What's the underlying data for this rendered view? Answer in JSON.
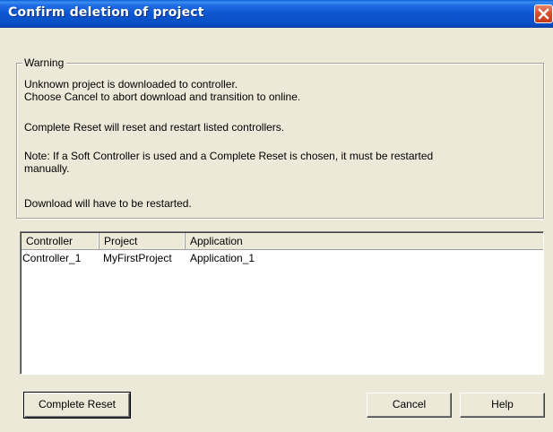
{
  "window": {
    "title": "Confirm deletion of project"
  },
  "warning": {
    "legend": "Warning",
    "lines": [
      "Unknown project is downloaded to controller.",
      "Choose Cancel to abort download and transition to online.",
      "Complete Reset will reset and restart listed controllers.",
      "Note: If a Soft Controller is used and a Complete Reset is chosen, it must be restarted",
      "manually.",
      "Download will have to be restarted."
    ]
  },
  "list": {
    "columns": [
      "Controller",
      "Project",
      "Application"
    ],
    "rows": [
      [
        "Controller_1",
        "MyFirstProject",
        "Application_1"
      ]
    ]
  },
  "buttons": {
    "complete_reset": "Complete Reset",
    "cancel": "Cancel",
    "help": "Help"
  },
  "colors": {
    "titlebar": "#0a51c8",
    "dialog_bg": "#ece9d8",
    "close_button": "#d8502d"
  },
  "icons": {
    "close": "close-icon"
  }
}
